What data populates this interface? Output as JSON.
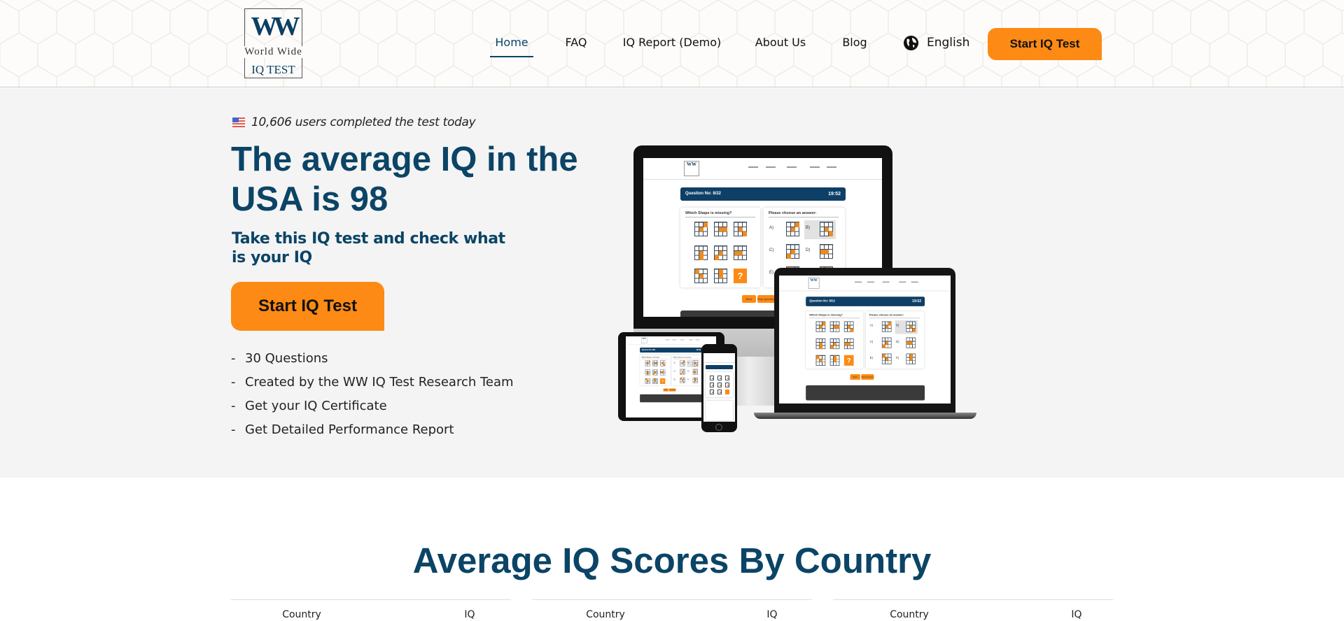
{
  "header": {
    "logo": {
      "mark": "WW",
      "line1": "World Wide",
      "line2": "IQ TEST"
    },
    "nav": [
      "Home",
      "FAQ",
      "IQ Report (Demo)",
      "About Us",
      "Blog"
    ],
    "active_nav": "Home",
    "language": "English",
    "cta": "Start IQ Test"
  },
  "hero": {
    "users_today": "10,606 users completed the test today",
    "title": "The average IQ in the USA is 98",
    "subtitle": "Take this IQ test and check what is your IQ",
    "cta": "Start IQ Test",
    "features": [
      "30 Questions",
      "Created by the WW IQ Test Research Team",
      "Get your IQ Certificate",
      "Get Detailed Performance Report"
    ],
    "bullet": "-"
  },
  "mockup": {
    "logo": "WW",
    "question": "Question No: 8/22",
    "timer": "19:52",
    "prompt": "Which Shape is missing?",
    "answer_prompt": "Please choose an answer:",
    "options": [
      "A)",
      "B)",
      "C)",
      "D)",
      "E)",
      "F)"
    ],
    "missing": "?",
    "back": "Back",
    "skip": "Skip Question"
  },
  "scores": {
    "title": "Average IQ Scores By Country",
    "tables": [
      {
        "col_country": "Country",
        "col_iq": "IQ"
      },
      {
        "col_country": "Country",
        "col_iq": "IQ"
      },
      {
        "col_country": "Country",
        "col_iq": "IQ"
      }
    ]
  },
  "colors": {
    "brand_blue": "#0b4466",
    "accent_orange": "#fd8a14",
    "hero_bg": "#f4f4f4"
  }
}
